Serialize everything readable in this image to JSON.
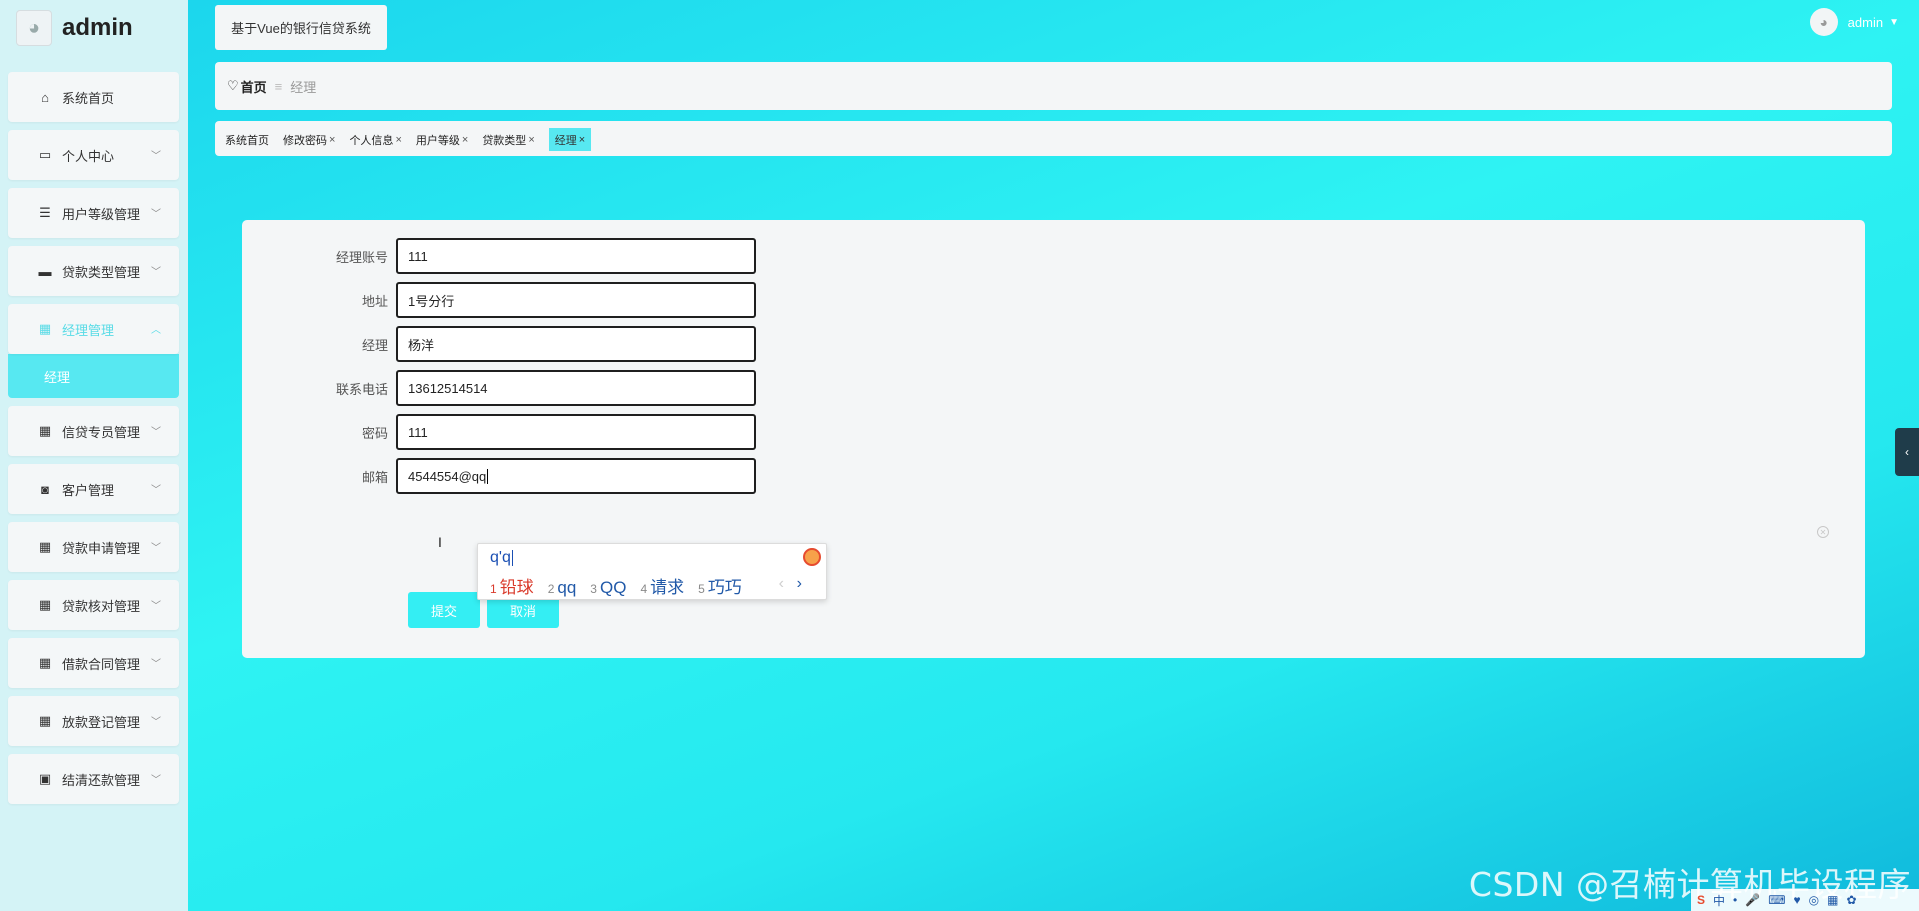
{
  "brand": {
    "title": "admin",
    "avatar_icon": "cat-avatar-icon"
  },
  "sidebar": {
    "items": [
      {
        "label": "系统首页",
        "icon": "home-icon",
        "glyph": "⌂",
        "has_children": false
      },
      {
        "label": "个人中心",
        "icon": "id-card-icon",
        "glyph": "▭",
        "has_children": true
      },
      {
        "label": "用户等级管理",
        "icon": "list-icon",
        "glyph": "☰",
        "has_children": true
      },
      {
        "label": "贷款类型管理",
        "icon": "printer-icon",
        "glyph": "▬",
        "has_children": true
      },
      {
        "label": "经理管理",
        "icon": "grid-icon",
        "glyph": "▦",
        "has_children": true,
        "expanded": true,
        "children": [
          {
            "label": "经理",
            "active": true
          }
        ]
      },
      {
        "label": "信贷专员管理",
        "icon": "grid-icon",
        "glyph": "▦",
        "has_children": true
      },
      {
        "label": "客户管理",
        "icon": "ticket-icon",
        "glyph": "◙",
        "has_children": true
      },
      {
        "label": "贷款申请管理",
        "icon": "grid-icon",
        "glyph": "▦",
        "has_children": true
      },
      {
        "label": "贷款核对管理",
        "icon": "grid-icon",
        "glyph": "▦",
        "has_children": true
      },
      {
        "label": "借款合同管理",
        "icon": "grid-icon",
        "glyph": "▦",
        "has_children": true
      },
      {
        "label": "放款登记管理",
        "icon": "grid-icon",
        "glyph": "▦",
        "has_children": true
      },
      {
        "label": "结清还款管理",
        "icon": "clipboard-icon",
        "glyph": "▣",
        "has_children": true
      }
    ]
  },
  "header": {
    "app_title": "基于Vue的银行信贷系统",
    "user_name": "admin"
  },
  "breadcrumb": {
    "home": "首页",
    "separator": "≡",
    "current": "经理"
  },
  "tags": [
    {
      "label": "系统首页",
      "closable": false,
      "active": false
    },
    {
      "label": "修改密码",
      "closable": true,
      "active": false
    },
    {
      "label": "个人信息",
      "closable": true,
      "active": false
    },
    {
      "label": "用户等级",
      "closable": true,
      "active": false
    },
    {
      "label": "贷款类型",
      "closable": true,
      "active": false
    },
    {
      "label": "经理",
      "closable": true,
      "active": true
    }
  ],
  "form": {
    "fields": [
      {
        "label": "经理账号",
        "value": "111"
      },
      {
        "label": "地址",
        "value": "1号分行"
      },
      {
        "label": "经理",
        "value": "杨洋"
      },
      {
        "label": "联系电话",
        "value": "13612514514"
      },
      {
        "label": "密码",
        "value": "111"
      },
      {
        "label": "邮箱",
        "value": "4544554@qq"
      }
    ],
    "submit_label": "提交",
    "cancel_label": "取消"
  },
  "ime": {
    "composition": "q'q",
    "candidates": [
      {
        "n": "1",
        "text": "铅球"
      },
      {
        "n": "2",
        "text": "qq"
      },
      {
        "n": "3",
        "text": "QQ"
      },
      {
        "n": "4",
        "text": "请求"
      },
      {
        "n": "5",
        "text": "巧巧"
      }
    ],
    "next": "›"
  },
  "watermark": "CSDN @召楠计算机毕设程序",
  "tray": {
    "items": [
      "中",
      "•",
      "🎤",
      "⌨",
      "♥",
      "◎",
      "▦",
      "✿"
    ]
  },
  "colors": {
    "accent": "#57e8f1",
    "button": "#34eef3",
    "active_text": "#58dbe6"
  }
}
